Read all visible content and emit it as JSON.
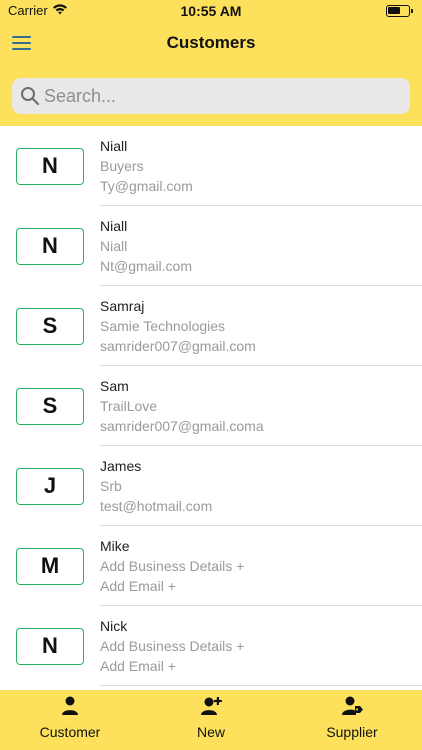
{
  "status": {
    "carrier": "Carrier",
    "time": "10:55 AM"
  },
  "header": {
    "title": "Customers"
  },
  "search": {
    "placeholder": "Search..."
  },
  "customers": [
    {
      "initial": "N",
      "name": "Niall",
      "business": "Buyers",
      "email": "Ty@gmail.com"
    },
    {
      "initial": "N",
      "name": "Niall",
      "business": "Niall",
      "email": "Nt@gmail.com"
    },
    {
      "initial": "S",
      "name": "Samraj",
      "business": "Samie Technologies",
      "email": "samrider007@gmail.com"
    },
    {
      "initial": "S",
      "name": "Sam",
      "business": "TrailLove",
      "email": "samrider007@gmail.coma"
    },
    {
      "initial": "J",
      "name": "James",
      "business": "Srb",
      "email": "test@hotmail.com"
    },
    {
      "initial": "M",
      "name": "Mike",
      "business": "Add Business Details +",
      "email": "Add Email +"
    },
    {
      "initial": "N",
      "name": "Nick",
      "business": "Add Business Details +",
      "email": "Add Email +"
    }
  ],
  "tabs": {
    "customer": {
      "label": "Customer",
      "icon": "person-icon"
    },
    "new": {
      "label": "New",
      "icon": "person-add-icon"
    },
    "supplier": {
      "label": "Supplier",
      "icon": "person-tag-icon"
    }
  },
  "colors": {
    "header": "#fde15c",
    "avatar_border": "#28b06a",
    "menu_icon": "#2f6f8f"
  }
}
